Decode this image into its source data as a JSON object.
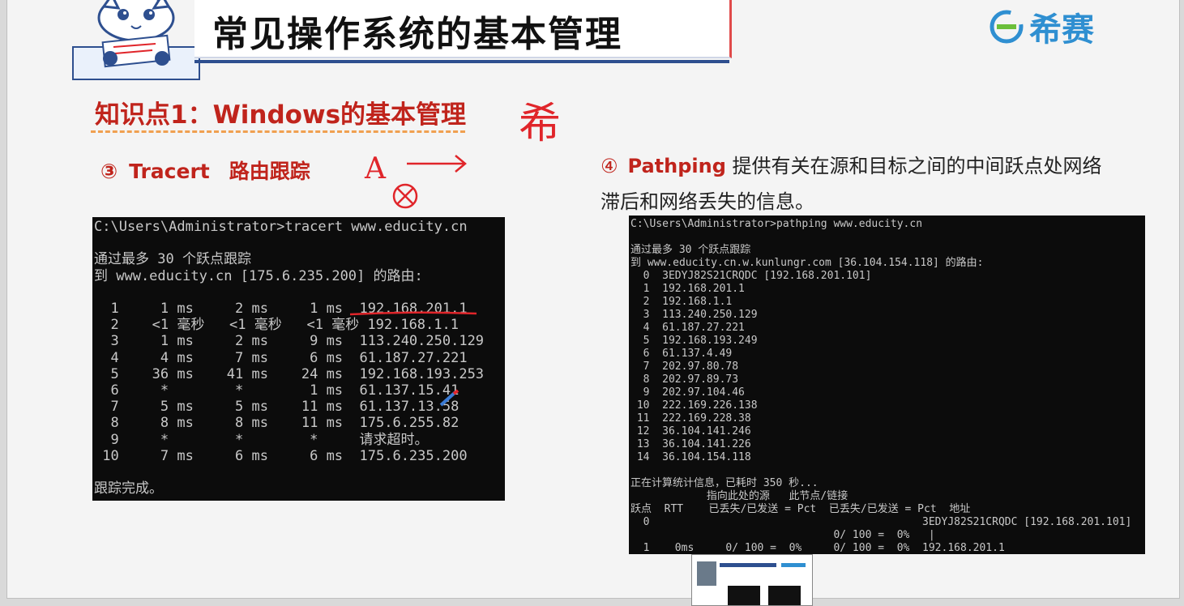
{
  "slide": {
    "title": "常见操作系统的基本管理",
    "brand": "希赛",
    "knowledge_point": "知识点1：Windows的基本管理",
    "handwritten_char": "希",
    "handwritten_letter": "A"
  },
  "sections": {
    "tracert": {
      "number": "③",
      "keyword": "Tracert",
      "description": "路由跟踪"
    },
    "pathping": {
      "number": "④",
      "keyword": "Pathping",
      "description": "提供有关在源和目标之间的中间跃点处网络滞后和网络丢失的信息。"
    }
  },
  "terminal_tracert": {
    "lines": [
      "C:\\Users\\Administrator>tracert www.educity.cn",
      "",
      "通过最多 30 个跃点跟踪",
      "到 www.educity.cn [175.6.235.200] 的路由:",
      "",
      "  1     1 ms     2 ms     1 ms  192.168.201.1",
      "  2    <1 毫秒   <1 毫秒   <1 毫秒 192.168.1.1",
      "  3     1 ms     2 ms     9 ms  113.240.250.129",
      "  4     4 ms     7 ms     6 ms  61.187.27.221",
      "  5    36 ms    41 ms    24 ms  192.168.193.253",
      "  6     *        *        1 ms  61.137.15.41",
      "  7     5 ms     5 ms    11 ms  61.137.13.58",
      "  8     8 ms     8 ms    11 ms  175.6.255.82",
      "  9     *        *        *     请求超时。",
      " 10     7 ms     6 ms     6 ms  175.6.235.200",
      "",
      "跟踪完成。"
    ]
  },
  "terminal_pathping": {
    "lines": [
      "C:\\Users\\Administrator>pathping www.educity.cn",
      "",
      "通过最多 30 个跃点跟踪",
      "到 www.educity.cn.w.kunlungr.com [36.104.154.118] 的路由:",
      "  0  3EDYJ82S21CRQDC [192.168.201.101]",
      "  1  192.168.201.1",
      "  2  192.168.1.1",
      "  3  113.240.250.129",
      "  4  61.187.27.221",
      "  5  192.168.193.249",
      "  6  61.137.4.49",
      "  7  202.97.80.78",
      "  8  202.97.89.73",
      "  9  202.97.104.46",
      " 10  222.169.226.138",
      " 11  222.169.228.38",
      " 12  36.104.141.246",
      " 13  36.104.141.226",
      " 14  36.104.154.118",
      "",
      "正在计算统计信息，已耗时 350 秒...",
      "            指向此处的源   此节点/链接",
      "跃点  RTT    已丢失/已发送 = Pct  已丢失/已发送 = Pct  地址",
      "  0                                           3EDYJ82S21CRQDC [192.168.201.101]",
      "                                0/ 100 =  0%   |",
      "  1    0ms     0/ 100 =  0%     0/ 100 =  0%  192.168.201.1"
    ]
  },
  "colors": {
    "accent_red": "#c0241c",
    "brand_blue": "#2f8fd1",
    "underline_orange": "#f0a050",
    "terminal_bg": "#0c0c0c"
  }
}
